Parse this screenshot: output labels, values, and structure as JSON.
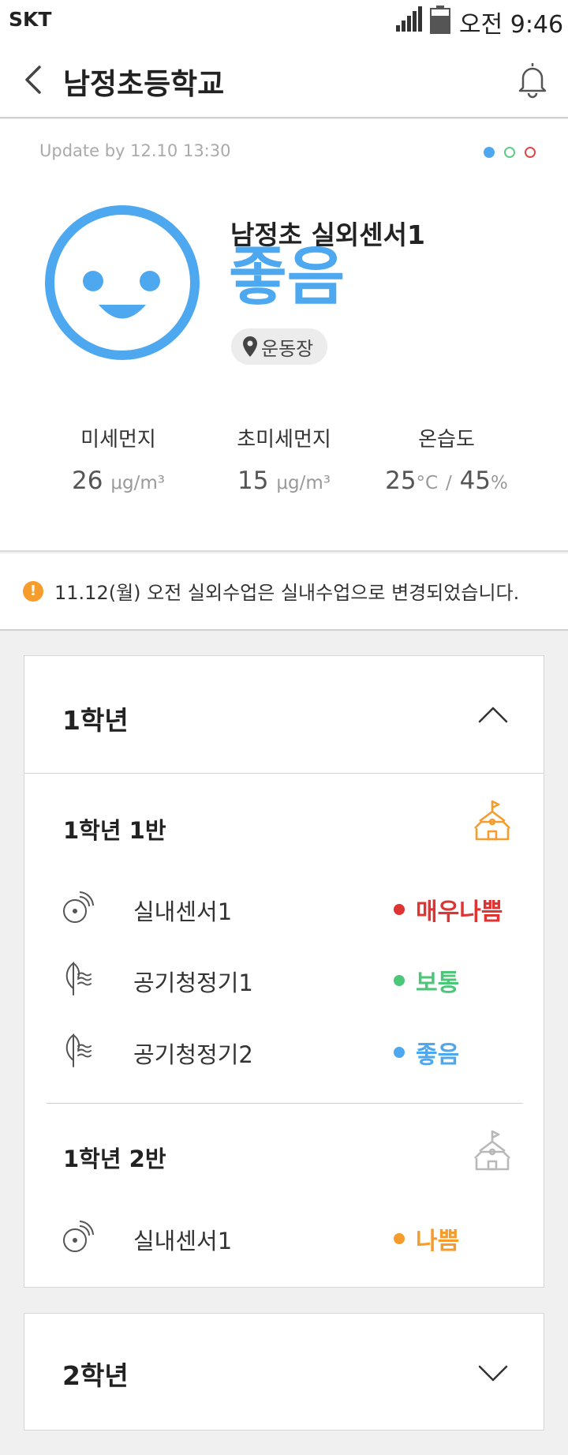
{
  "status_bar": {
    "carrier": "SKT",
    "time": "오전 9:46"
  },
  "app_bar": {
    "title": "남정초등학교"
  },
  "summary": {
    "update_text": "Update by 12.10 13:30",
    "sensor_name": "남정초 실외센서1",
    "status": "좋음",
    "status_color": "#4ea8ef",
    "location": "운동장",
    "metrics": [
      {
        "label": "미세먼지",
        "value": "26",
        "unit": "μg/m³"
      },
      {
        "label": "초미세먼지",
        "value": "15",
        "unit": "μg/m³"
      },
      {
        "label": "온습도",
        "temp": "25",
        "temp_unit": "°C",
        "sep": "/",
        "humidity": "45",
        "humidity_unit": "%"
      }
    ]
  },
  "notice": {
    "text": "11.12(월) 오전 실외수업은 실내수업으로 변경되었습니다."
  },
  "grades": [
    {
      "title": "1학년",
      "expanded": true,
      "classes": [
        {
          "title": "1학년 1반",
          "icon_color": "#f59c2c",
          "devices": [
            {
              "icon": "indoor-sensor-icon",
              "label": "실내센서1",
              "status": "매우나쁨",
              "color": "#e03434"
            },
            {
              "icon": "air-purifier-icon",
              "label": "공기청정기1",
              "status": "보통",
              "color": "#4cc77a"
            },
            {
              "icon": "air-purifier-icon",
              "label": "공기청정기2",
              "status": "좋음",
              "color": "#4ea8ef"
            }
          ]
        },
        {
          "title": "1학년 2반",
          "icon_color": "#b8b8b8",
          "devices": [
            {
              "icon": "indoor-sensor-icon",
              "label": "실내센서1",
              "status": "나쁨",
              "color": "#f59c2c"
            }
          ]
        }
      ]
    },
    {
      "title": "2학년",
      "expanded": false
    }
  ]
}
